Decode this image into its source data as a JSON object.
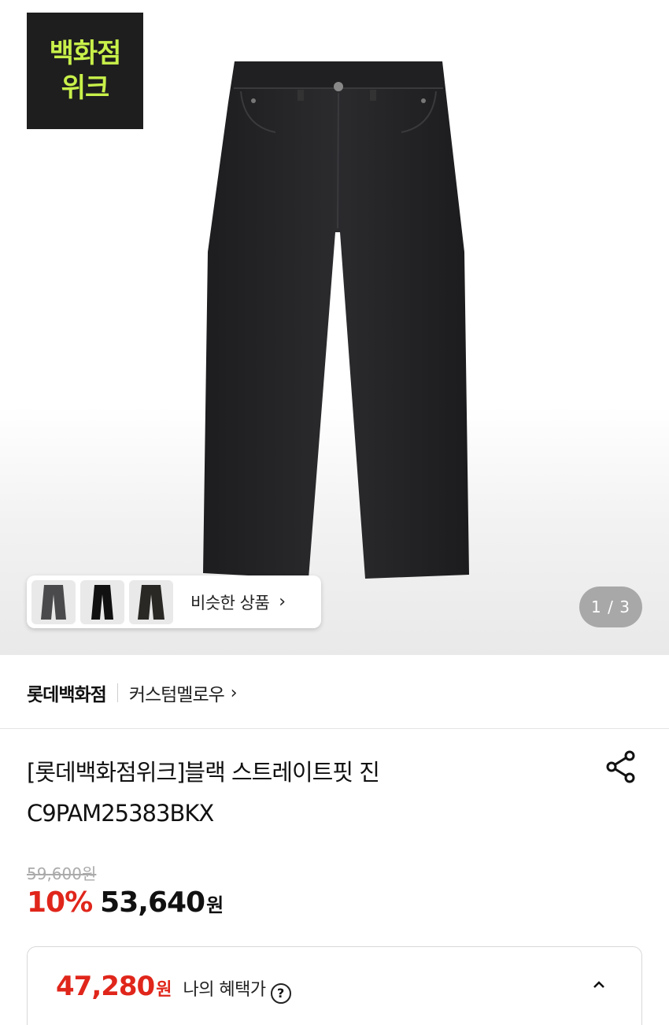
{
  "badge": {
    "line1": "백화점",
    "line2": "위크"
  },
  "similar": {
    "label": "비슷한 상품",
    "chevron": "›"
  },
  "gallery": {
    "counter": "1 / 3"
  },
  "brand": {
    "store": "롯데백화점",
    "name": "커스텀멜로우",
    "chevron": "›"
  },
  "product": {
    "title_line1": "[롯데백화점위크]블랙 스트레이트핏 진",
    "title_line2": "C9PAM25383BKX",
    "original_price": "59,600원",
    "discount": "10%",
    "sale_price": "53,640",
    "sale_currency": "원"
  },
  "benefit": {
    "price": "47,280",
    "currency": "원",
    "label": "나의 혜택가",
    "help": "?"
  },
  "colors": {
    "accent": "#e0261b",
    "badge_bg": "#1e1e1e",
    "badge_text": "#c8f04a"
  },
  "icons": [
    "share-icon",
    "help-icon",
    "chevron-up-icon",
    "chevron-right-icon"
  ]
}
